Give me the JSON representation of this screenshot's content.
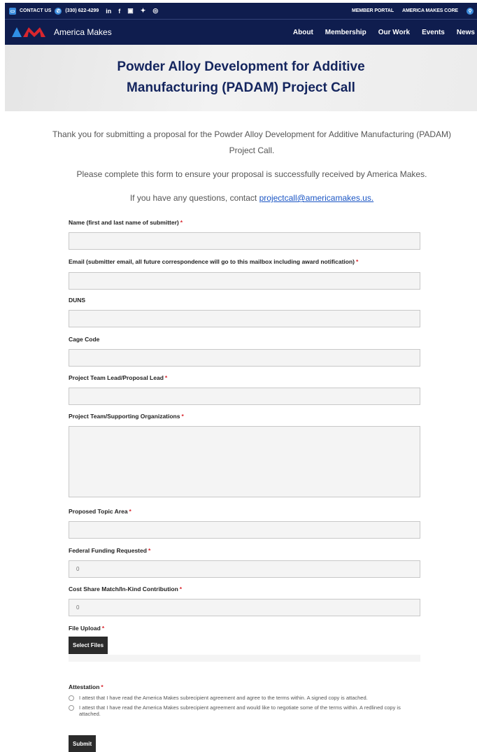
{
  "topbar": {
    "contact_label": "CONTACT US",
    "phone": "(330) 622-4299",
    "social": [
      "in",
      "f",
      "▣",
      "🐦",
      "◎"
    ],
    "member_portal": "MEMBER PORTAL",
    "core": "AMERICA MAKES CORE"
  },
  "nav": {
    "brand": "America Makes",
    "links": [
      "About",
      "Membership",
      "Our Work",
      "Events",
      "News"
    ]
  },
  "hero": {
    "title": "Powder Alloy Development for Additive Manufacturing (PADAM) Project Call"
  },
  "intro": {
    "p1": "Thank you for submitting a proposal for the Powder Alloy Development for Additive Manufacturing (PADAM) Project Call.",
    "p2": "Please complete this form to ensure your proposal is successfully received by America Makes.",
    "p3_prefix": "If you have any questions, contact ",
    "email": "projectcall@americamakes.us."
  },
  "form": {
    "name_label": "Name (first and last name of submitter)",
    "email_label": "Email (submitter email, all future correspondence will go to this mailbox including award notification)",
    "duns_label": "DUNS",
    "cage_label": "Cage Code",
    "lead_label": "Project Team Lead/Proposal Lead",
    "team_label": "Project Team/Supporting Organizations",
    "topic_label": "Proposed Topic Area",
    "funding_label": "Federal Funding Requested",
    "funding_value": "0",
    "cost_label": "Cost Share Match/In-Kind Contribution",
    "cost_value": "0",
    "upload_label": "File Upload",
    "select_files": "Select Files",
    "attestation_label": "Attestation",
    "attest_opt1": "I attest that I have read the America Makes subrecipient agreement and agree to the terms within. A signed copy is attached.",
    "attest_opt2": "I attest that I have read the America Makes subrecipient agreement and would like to negotiate some of the terms within. A redlined copy is attached.",
    "submit": "Submit",
    "required_mark": "*"
  }
}
